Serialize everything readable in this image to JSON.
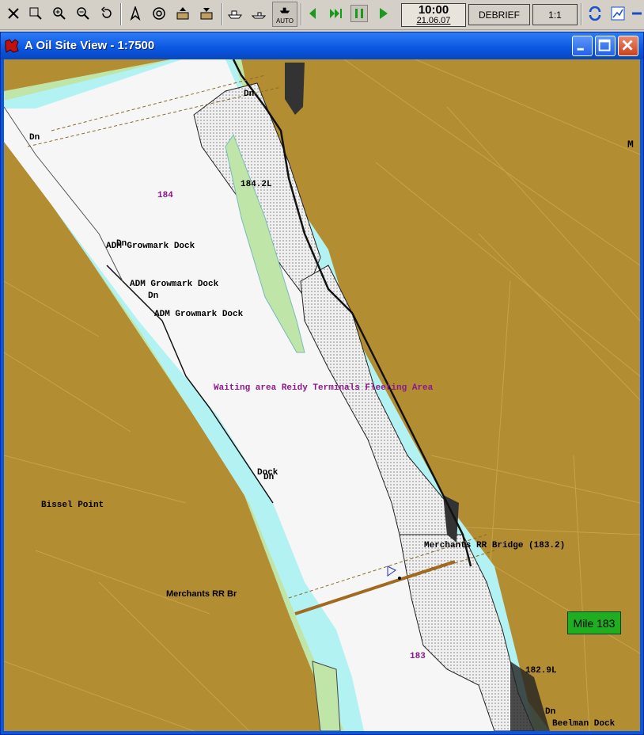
{
  "toolbar": {
    "icons": [
      "select-icon",
      "zoom-window-icon",
      "zoom-in-icon",
      "zoom-out-icon",
      "undo-zoom-icon",
      "north-arrow-icon",
      "target-icon",
      "upload-icon",
      "download-icon",
      "vessel-icon",
      "vessel-outline-icon",
      "auto-vessel-icon",
      "step-back-icon",
      "fast-forward-icon",
      "pause-icon",
      "play-icon",
      "sync-icon",
      "chart-icon"
    ],
    "auto_label": "AUTO",
    "clock_time": "10:00",
    "clock_date": "21.06.07",
    "debrief_label": "DEBRIEF",
    "scale_label": "1:1"
  },
  "window": {
    "title": "A Oil Site View - 1:7500"
  },
  "map": {
    "colors": {
      "land": "#b38d32",
      "water_deep": "#f4f4f4",
      "water_shallow": "#b3f2f2",
      "green_bank": "#bfe6a8",
      "bridge": "#a06a20",
      "label_purple": "#8a1a8a"
    },
    "labels": {
      "dn_top": "Dn",
      "dn_left": "Dn",
      "mile_184": "184",
      "l_184_2": "184.2L",
      "dn_mid": "Dn",
      "adm1": "ADM Growmark Dock",
      "adm2": "ADM Growmark Dock",
      "dn_mid2": "Dn",
      "adm3": "ADM Growmark Dock",
      "waiting": "Waiting area Reidy Terminals Fleeting Area",
      "dock": "Dock",
      "dn_dock": "Dn",
      "bissel": "Bissel Point",
      "merchants_bridge": "Merchants RR Bridge (183.2)",
      "merchants_br": "Merchants RR Br",
      "mile_183": "183",
      "l_182_9": "182.9L",
      "dn_bottom": "Dn",
      "beelman": "Beelman Dock",
      "m_edge": "M"
    },
    "mile_badge": "Mile 183"
  }
}
